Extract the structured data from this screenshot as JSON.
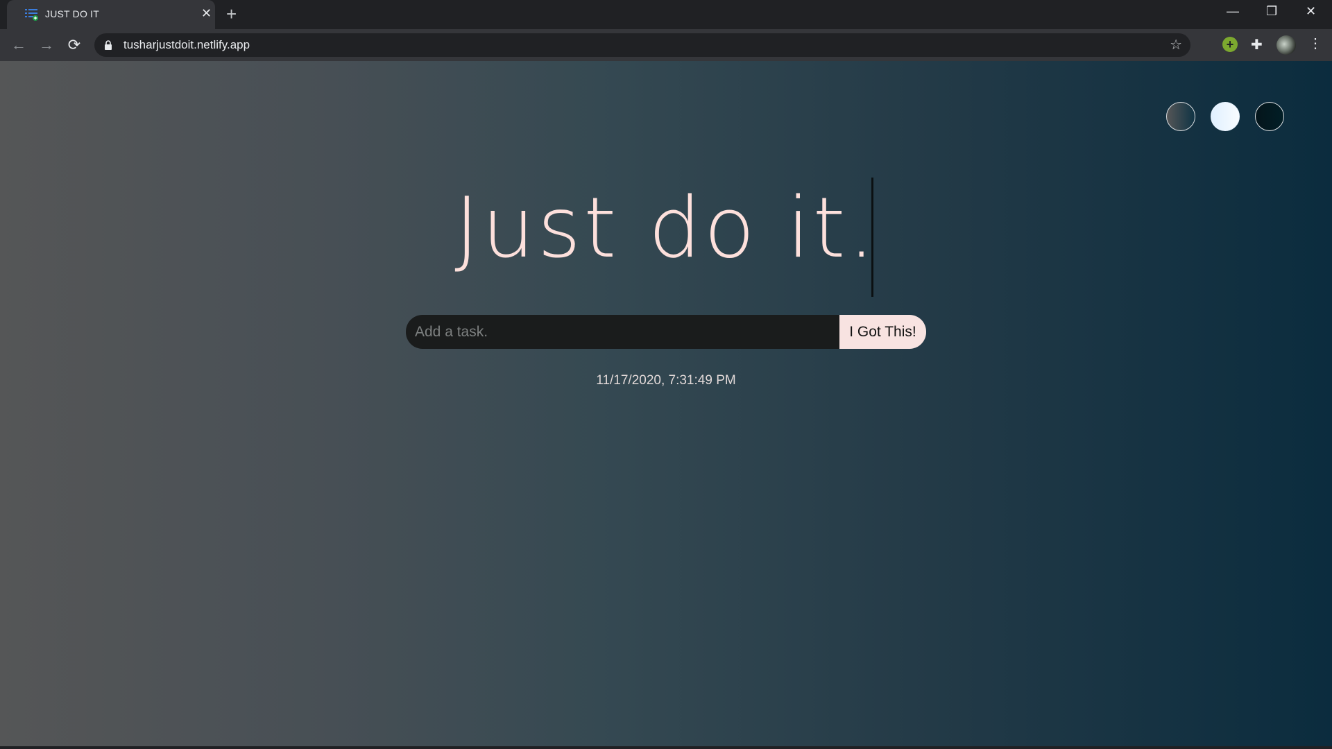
{
  "browser": {
    "tab": {
      "title": "JUST DO IT",
      "icon": "list-add-icon",
      "close": "✕"
    },
    "new_tab": "+",
    "window_controls": {
      "minimize": "—",
      "restore": "❐",
      "close": "✕"
    },
    "nav": {
      "back": "←",
      "forward": "→",
      "reload": "⟳"
    },
    "url": "tusharjustdoit.netlify.app",
    "bookmark": "☆",
    "extension_plus": "+",
    "extensions": "✚",
    "menu": "⋮"
  },
  "page": {
    "theme_swatches": [
      {
        "name": "gray-teal",
        "colors": [
          "#555657",
          "#0f3344"
        ]
      },
      {
        "name": "light-blue",
        "colors": [
          "#e0f0ff",
          "#f8fcff"
        ]
      },
      {
        "name": "dark-navy",
        "colors": [
          "#04151b",
          "#021e26"
        ]
      }
    ],
    "title": "Just do it.",
    "task_input": {
      "placeholder": "Add a task.",
      "value": ""
    },
    "submit_label": "I Got This!",
    "datetime": "11/17/2020, 7:31:49 PM",
    "colors": {
      "title": "#fde0dc",
      "button_bg": "#f8e3e1",
      "input_bg": "#1a1c1c"
    }
  }
}
